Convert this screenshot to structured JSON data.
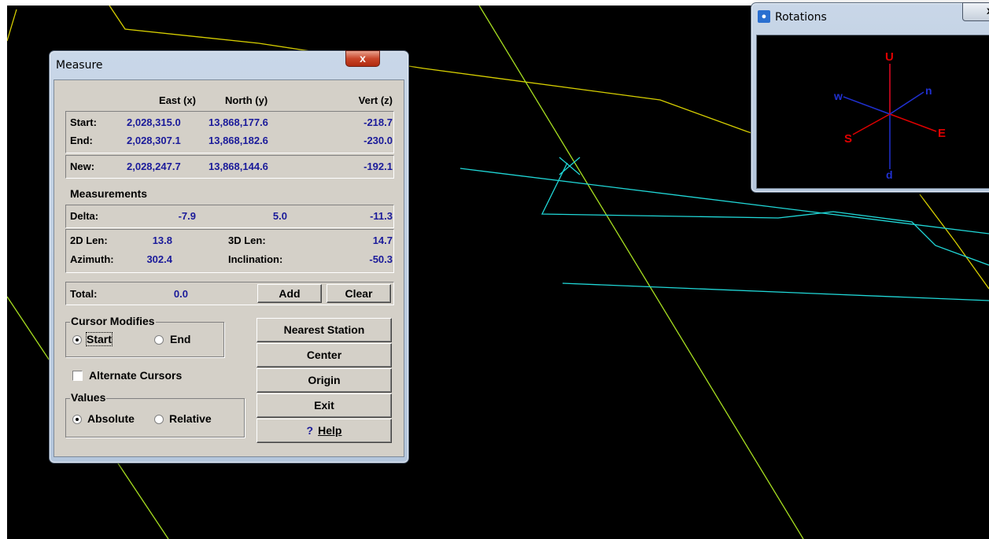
{
  "measure": {
    "title": "Measure",
    "close_glyph": "x",
    "headers": {
      "east": "East (x)",
      "north": "North (y)",
      "vert": "Vert (z)"
    },
    "start": {
      "label": "Start:",
      "east": "2,028,315.0",
      "north": "13,868,177.6",
      "vert": "-218.7"
    },
    "end": {
      "label": "End:",
      "east": "2,028,307.1",
      "north": "13,868,182.6",
      "vert": "-230.0"
    },
    "new": {
      "label": "New:",
      "east": "2,028,247.7",
      "north": "13,868,144.6",
      "vert": "-192.1"
    },
    "measurements_heading": "Measurements",
    "delta": {
      "label": "Delta:",
      "east": "-7.9",
      "north": "5.0",
      "vert": "-11.3"
    },
    "len2d": {
      "label": "2D Len:",
      "value": "13.8"
    },
    "len3d": {
      "label": "3D Len:",
      "value": "14.7"
    },
    "azimuth": {
      "label": "Azimuth:",
      "value": "302.4"
    },
    "inclination": {
      "label": "Inclination:",
      "value": "-50.3"
    },
    "total": {
      "label": "Total:",
      "value": "0.0"
    },
    "add_label": "Add",
    "clear_label": "Clear",
    "cursor_modifies": {
      "label": "Cursor Modifies",
      "start": "Start",
      "end": "End",
      "selected": "start"
    },
    "alternate_cursors": {
      "label": "Alternate Cursors",
      "checked": false
    },
    "values_group": {
      "label": "Values",
      "absolute": "Absolute",
      "relative": "Relative",
      "selected": "absolute"
    },
    "buttons": {
      "nearest_station": "Nearest Station",
      "center": "Center",
      "origin": "Origin",
      "exit": "Exit",
      "help": "Help",
      "help_icon": "question-mark-icon"
    }
  },
  "rotations": {
    "title": "Rotations",
    "close_glyph": "x",
    "axes": {
      "up": "U",
      "north": "n",
      "west": "w",
      "south": "S",
      "east": "E",
      "down": "d"
    }
  },
  "colors": {
    "background": "#000000",
    "yellow_line": "#d8d000",
    "green_line": "#a8e020",
    "cyan_line": "#20d8d8",
    "axis_red": "#e00000",
    "axis_blue": "#2030d0",
    "value_blue": "#1a1a9a"
  }
}
